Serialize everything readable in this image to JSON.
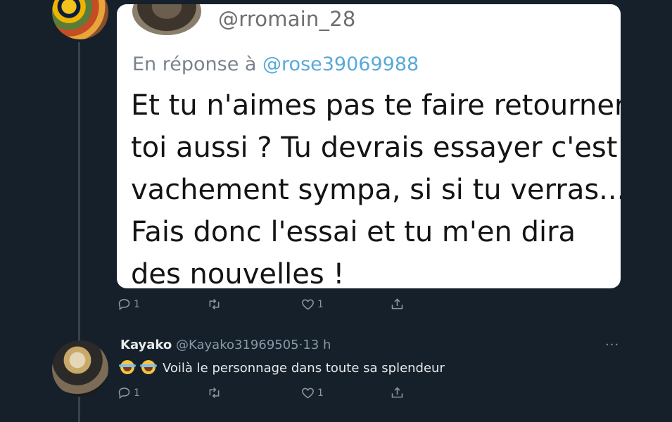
{
  "quoted_tweet": {
    "handle": "@rromain_28",
    "reply_prefix": "En réponse à",
    "reply_mention": "@rose39069988",
    "lines": [
      "Et tu n'aimes pas te faire retourner",
      "toi aussi ? Tu devrais essayer c'est",
      "vachement sympa, si si tu verras...",
      "Fais donc l'essai et tu m'en dira",
      "des nouvelles !"
    ]
  },
  "tweet_actions": {
    "reply_icon": "reply-icon",
    "reply_count": "1",
    "retweet_icon": "retweet-icon",
    "like_icon": "heart-icon",
    "like_count": "1",
    "share_icon": "share-icon"
  },
  "reply_tweet": {
    "name": "Kayako",
    "handle": "@Kayako31969505",
    "separator": "·",
    "time": "13 h",
    "more": "···",
    "emoji": "face-with-tears-of-joy",
    "text": "Voilà le personnage dans toute sa splendeur",
    "reply_count": "1",
    "like_count": "1"
  },
  "colors": {
    "background": "#15202b",
    "thread_line": "#38444d",
    "mention": "#58a9d8",
    "muted": "#8899a6",
    "text": "#e7e9ea"
  }
}
